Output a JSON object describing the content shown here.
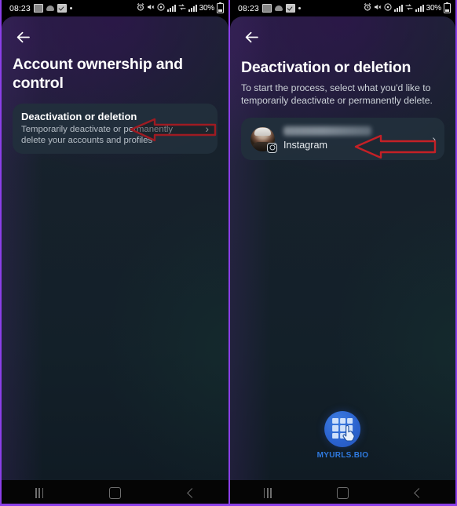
{
  "meta": {
    "watermark_color": "#2f7ae0",
    "accent_border": "#8b3fe8",
    "annotation_red": "#c42026"
  },
  "status_bar": {
    "clock": "08:23",
    "battery_percent": "30%",
    "left_icons": [
      "image-icon",
      "cloud-upload-icon",
      "checkbox-icon",
      "dot-icon"
    ],
    "right_icons": [
      "alarm-icon",
      "mute-icon",
      "wifi-hotspot-icon",
      "signal-bars-icon",
      "sim-swap-icon",
      "signal-bars-icon",
      "battery-icon"
    ]
  },
  "left_screen": {
    "back_label": "Back",
    "title": "Account ownership and control",
    "card": {
      "title": "Deactivation or deletion",
      "description": "Temporarily deactivate or permanently delete your accounts and profiles",
      "chevron": "›"
    },
    "annotation": "left-pointing-arrow"
  },
  "right_screen": {
    "back_label": "Back",
    "title": "Deactivation or deletion",
    "subtitle": "To start the process, select what you'd like to temporarily deactivate or permanently delete.",
    "account": {
      "name_redacted": "",
      "platform": "Instagram",
      "chevron": "›"
    },
    "annotation": "left-pointing-arrow"
  },
  "watermark": {
    "label": "MYURLS.BIO"
  },
  "nav_bar": {
    "recents_label": "Recents",
    "home_label": "Home",
    "back_label": "Back"
  }
}
